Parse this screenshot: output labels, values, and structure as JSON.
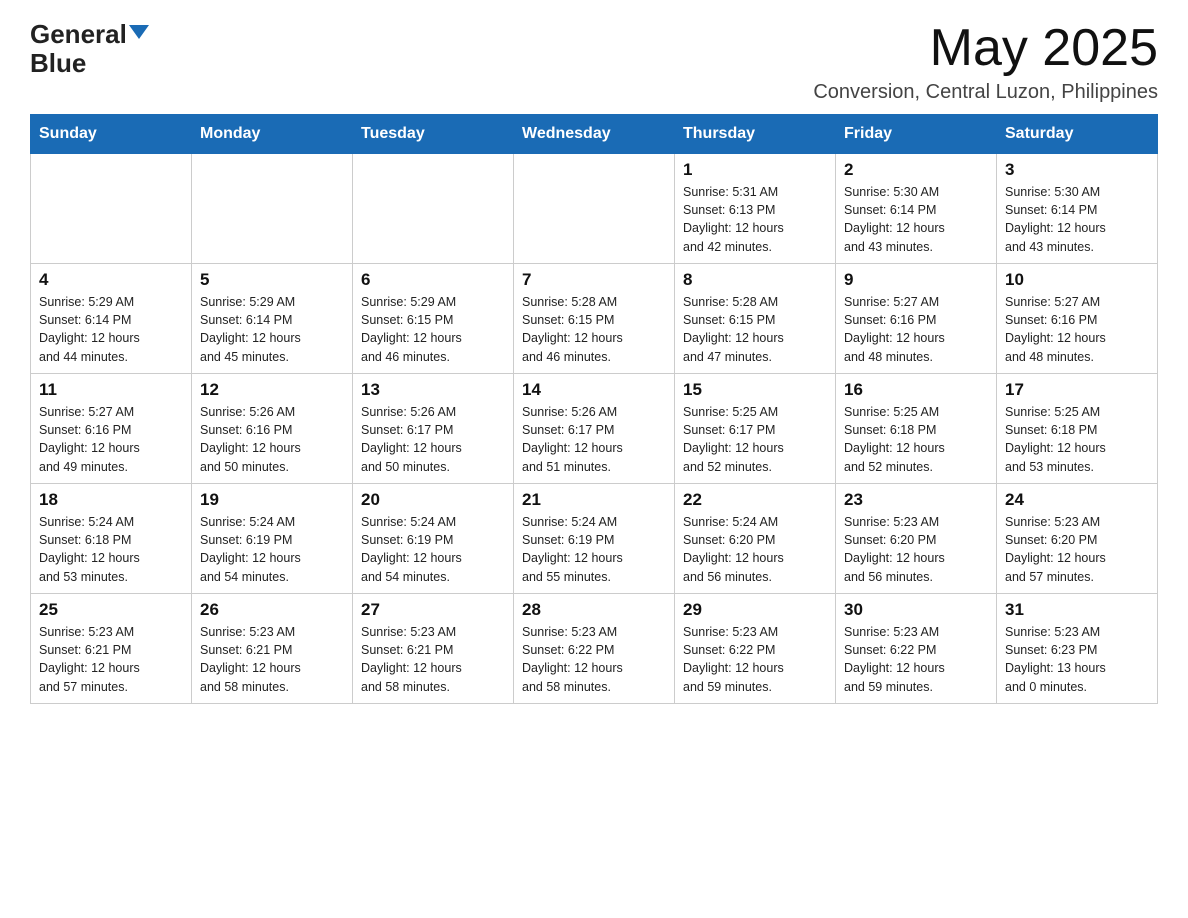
{
  "header": {
    "logo_general": "General",
    "logo_blue": "Blue",
    "month": "May 2025",
    "location": "Conversion, Central Luzon, Philippines"
  },
  "days_of_week": [
    "Sunday",
    "Monday",
    "Tuesday",
    "Wednesday",
    "Thursday",
    "Friday",
    "Saturday"
  ],
  "weeks": [
    [
      {
        "day": "",
        "info": ""
      },
      {
        "day": "",
        "info": ""
      },
      {
        "day": "",
        "info": ""
      },
      {
        "day": "",
        "info": ""
      },
      {
        "day": "1",
        "info": "Sunrise: 5:31 AM\nSunset: 6:13 PM\nDaylight: 12 hours\nand 42 minutes."
      },
      {
        "day": "2",
        "info": "Sunrise: 5:30 AM\nSunset: 6:14 PM\nDaylight: 12 hours\nand 43 minutes."
      },
      {
        "day": "3",
        "info": "Sunrise: 5:30 AM\nSunset: 6:14 PM\nDaylight: 12 hours\nand 43 minutes."
      }
    ],
    [
      {
        "day": "4",
        "info": "Sunrise: 5:29 AM\nSunset: 6:14 PM\nDaylight: 12 hours\nand 44 minutes."
      },
      {
        "day": "5",
        "info": "Sunrise: 5:29 AM\nSunset: 6:14 PM\nDaylight: 12 hours\nand 45 minutes."
      },
      {
        "day": "6",
        "info": "Sunrise: 5:29 AM\nSunset: 6:15 PM\nDaylight: 12 hours\nand 46 minutes."
      },
      {
        "day": "7",
        "info": "Sunrise: 5:28 AM\nSunset: 6:15 PM\nDaylight: 12 hours\nand 46 minutes."
      },
      {
        "day": "8",
        "info": "Sunrise: 5:28 AM\nSunset: 6:15 PM\nDaylight: 12 hours\nand 47 minutes."
      },
      {
        "day": "9",
        "info": "Sunrise: 5:27 AM\nSunset: 6:16 PM\nDaylight: 12 hours\nand 48 minutes."
      },
      {
        "day": "10",
        "info": "Sunrise: 5:27 AM\nSunset: 6:16 PM\nDaylight: 12 hours\nand 48 minutes."
      }
    ],
    [
      {
        "day": "11",
        "info": "Sunrise: 5:27 AM\nSunset: 6:16 PM\nDaylight: 12 hours\nand 49 minutes."
      },
      {
        "day": "12",
        "info": "Sunrise: 5:26 AM\nSunset: 6:16 PM\nDaylight: 12 hours\nand 50 minutes."
      },
      {
        "day": "13",
        "info": "Sunrise: 5:26 AM\nSunset: 6:17 PM\nDaylight: 12 hours\nand 50 minutes."
      },
      {
        "day": "14",
        "info": "Sunrise: 5:26 AM\nSunset: 6:17 PM\nDaylight: 12 hours\nand 51 minutes."
      },
      {
        "day": "15",
        "info": "Sunrise: 5:25 AM\nSunset: 6:17 PM\nDaylight: 12 hours\nand 52 minutes."
      },
      {
        "day": "16",
        "info": "Sunrise: 5:25 AM\nSunset: 6:18 PM\nDaylight: 12 hours\nand 52 minutes."
      },
      {
        "day": "17",
        "info": "Sunrise: 5:25 AM\nSunset: 6:18 PM\nDaylight: 12 hours\nand 53 minutes."
      }
    ],
    [
      {
        "day": "18",
        "info": "Sunrise: 5:24 AM\nSunset: 6:18 PM\nDaylight: 12 hours\nand 53 minutes."
      },
      {
        "day": "19",
        "info": "Sunrise: 5:24 AM\nSunset: 6:19 PM\nDaylight: 12 hours\nand 54 minutes."
      },
      {
        "day": "20",
        "info": "Sunrise: 5:24 AM\nSunset: 6:19 PM\nDaylight: 12 hours\nand 54 minutes."
      },
      {
        "day": "21",
        "info": "Sunrise: 5:24 AM\nSunset: 6:19 PM\nDaylight: 12 hours\nand 55 minutes."
      },
      {
        "day": "22",
        "info": "Sunrise: 5:24 AM\nSunset: 6:20 PM\nDaylight: 12 hours\nand 56 minutes."
      },
      {
        "day": "23",
        "info": "Sunrise: 5:23 AM\nSunset: 6:20 PM\nDaylight: 12 hours\nand 56 minutes."
      },
      {
        "day": "24",
        "info": "Sunrise: 5:23 AM\nSunset: 6:20 PM\nDaylight: 12 hours\nand 57 minutes."
      }
    ],
    [
      {
        "day": "25",
        "info": "Sunrise: 5:23 AM\nSunset: 6:21 PM\nDaylight: 12 hours\nand 57 minutes."
      },
      {
        "day": "26",
        "info": "Sunrise: 5:23 AM\nSunset: 6:21 PM\nDaylight: 12 hours\nand 58 minutes."
      },
      {
        "day": "27",
        "info": "Sunrise: 5:23 AM\nSunset: 6:21 PM\nDaylight: 12 hours\nand 58 minutes."
      },
      {
        "day": "28",
        "info": "Sunrise: 5:23 AM\nSunset: 6:22 PM\nDaylight: 12 hours\nand 58 minutes."
      },
      {
        "day": "29",
        "info": "Sunrise: 5:23 AM\nSunset: 6:22 PM\nDaylight: 12 hours\nand 59 minutes."
      },
      {
        "day": "30",
        "info": "Sunrise: 5:23 AM\nSunset: 6:22 PM\nDaylight: 12 hours\nand 59 minutes."
      },
      {
        "day": "31",
        "info": "Sunrise: 5:23 AM\nSunset: 6:23 PM\nDaylight: 13 hours\nand 0 minutes."
      }
    ]
  ]
}
